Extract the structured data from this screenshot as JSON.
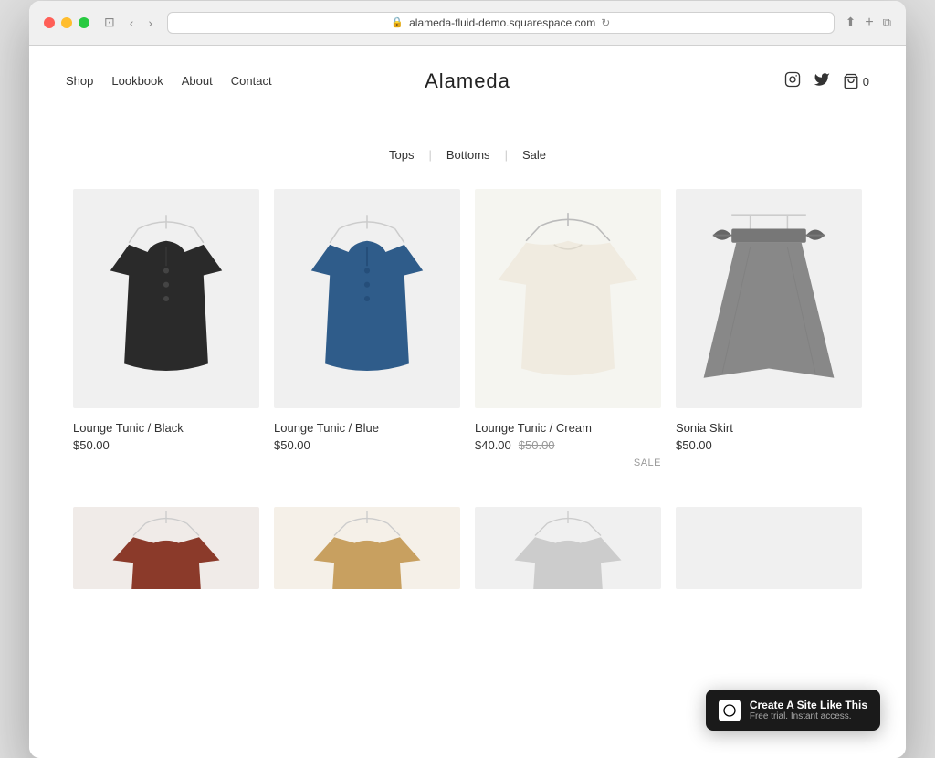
{
  "browser": {
    "url": "alameda-fluid-demo.squarespace.com",
    "lock_icon": "🔒"
  },
  "site": {
    "title": "Alameda",
    "nav": {
      "links": [
        {
          "label": "Shop",
          "active": true
        },
        {
          "label": "Lookbook",
          "active": false
        },
        {
          "label": "About",
          "active": false
        },
        {
          "label": "Contact",
          "active": false
        }
      ]
    },
    "header_icons": {
      "instagram": "IG",
      "twitter": "TW",
      "cart_label": "0"
    },
    "categories": [
      {
        "label": "Tops"
      },
      {
        "label": "Bottoms"
      },
      {
        "label": "Sale"
      }
    ],
    "products": [
      {
        "name": "Lounge Tunic / Black",
        "price": "$50.00",
        "original_price": null,
        "on_sale": false,
        "bg_color": "#f0f0f0",
        "garment_color": "#2a2a2a"
      },
      {
        "name": "Lounge Tunic / Blue",
        "price": "$50.00",
        "original_price": null,
        "on_sale": false,
        "bg_color": "#f0f0f0",
        "garment_color": "#2f5c8a"
      },
      {
        "name": "Lounge Tunic / Cream",
        "price": "$40.00",
        "original_price": "$50.00",
        "on_sale": true,
        "bg_color": "#f5f5f0",
        "garment_color": "#f0ebe0"
      },
      {
        "name": "Sonia Skirt",
        "price": "$50.00",
        "original_price": null,
        "on_sale": false,
        "bg_color": "#f0f0f0",
        "garment_color": "#888"
      }
    ],
    "row2_products": [
      {
        "bg_color": "#f0ebe8",
        "garment_color": "#8B3A2A"
      },
      {
        "bg_color": "#f5f0e8",
        "garment_color": "#c8a060"
      },
      {
        "bg_color": "#f0f0f0",
        "garment_color": "#ccc"
      },
      {
        "bg_color": "#f0f0f0",
        "garment_color": "#888"
      }
    ],
    "sale_label": "SALE"
  },
  "squarespace_banner": {
    "logo_char": "◼",
    "main_text": "Create A Site Like This",
    "sub_text": "Free trial. Instant access."
  }
}
